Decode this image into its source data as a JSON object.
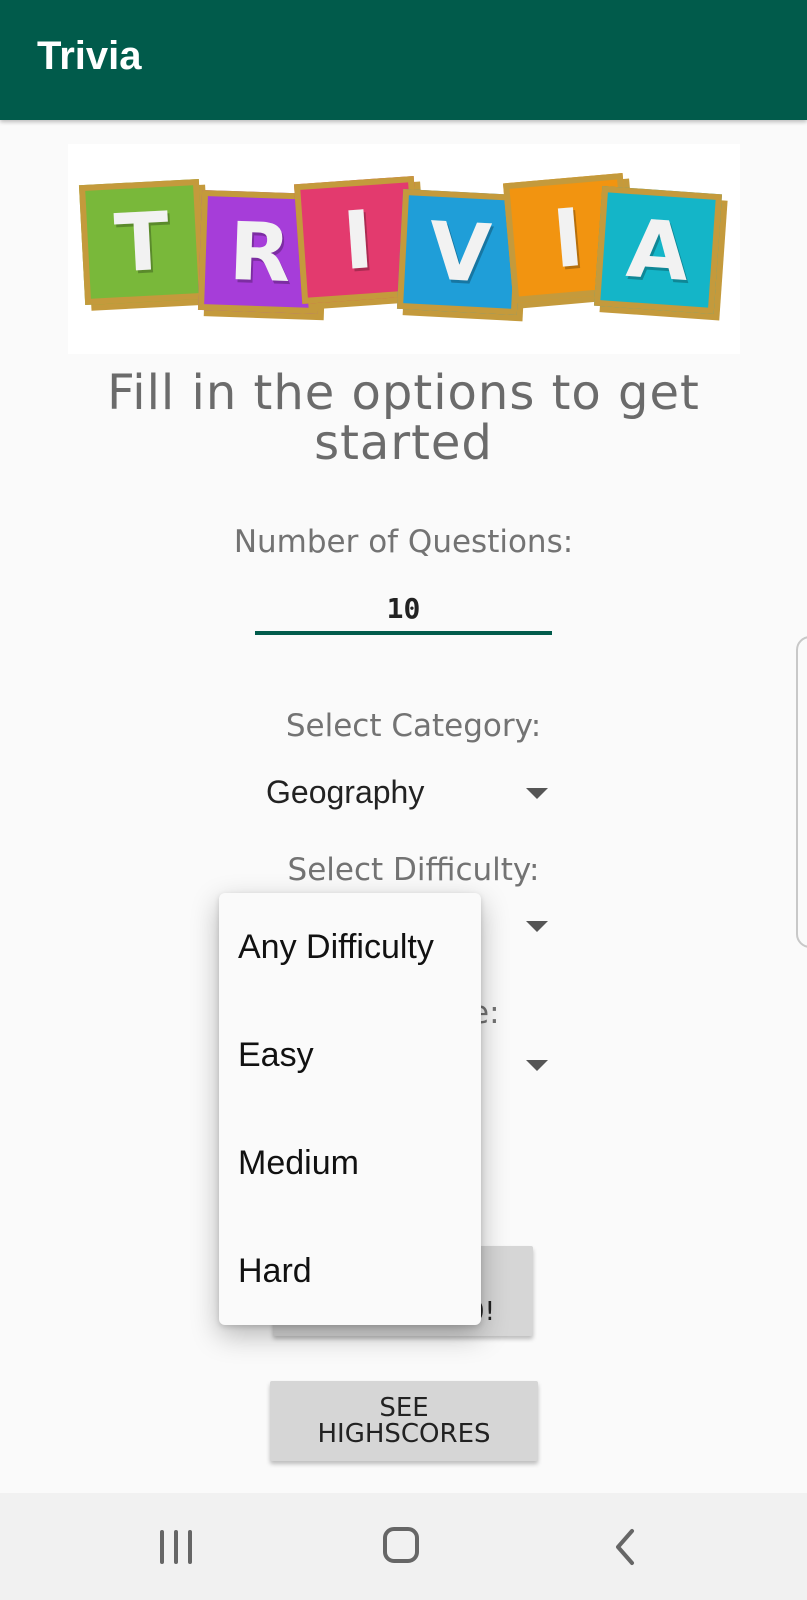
{
  "app": {
    "title": "Trivia"
  },
  "logo": {
    "letters": [
      "T",
      "R",
      "I",
      "V",
      "I",
      "A"
    ],
    "colors": [
      "#79b83a",
      "#a63dd9",
      "#e33a6e",
      "#1f9ed8",
      "#f29410",
      "#14b5c8"
    ]
  },
  "heading": "Fill in the options to get started",
  "questions": {
    "label": "Number of Questions:",
    "value": "10"
  },
  "category": {
    "label": "Select Category:",
    "value": "Geography"
  },
  "difficulty": {
    "label": "Select Difficulty:"
  },
  "type": {
    "label_visible": "e:"
  },
  "buttons": {
    "go_partial": "0!",
    "highscores": "SEE HIGHSCORES"
  },
  "dropdown": {
    "options": [
      "Any Difficulty",
      "Easy",
      "Medium",
      "Hard"
    ]
  },
  "navbar": {
    "recent_icon": "recent-apps-icon",
    "home_icon": "home-icon",
    "back_icon": "back-icon"
  }
}
